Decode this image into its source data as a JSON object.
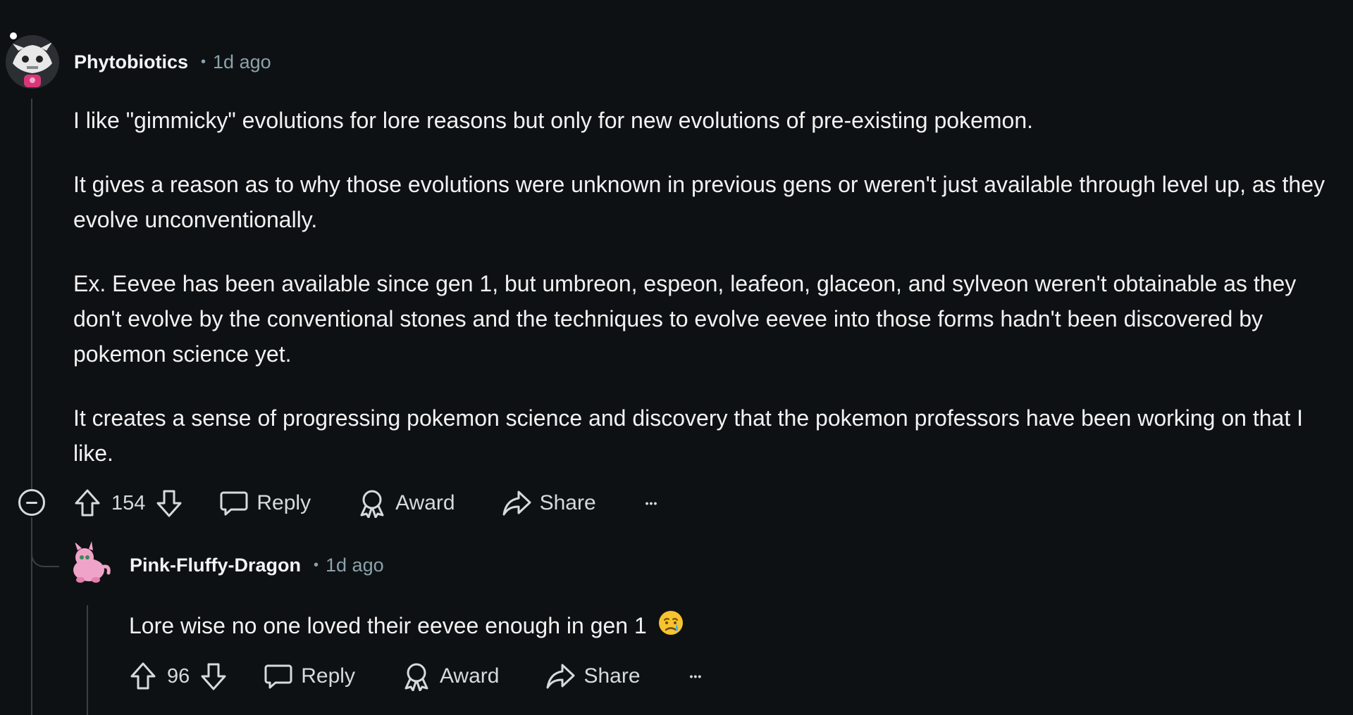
{
  "comment": {
    "author": "Phytobiotics",
    "timestamp": "1d ago",
    "paragraphs": [
      "I like \"gimmicky\" evolutions for lore reasons but only for new evolutions of pre-existing pokemon.",
      "It gives a reason as to why those evolutions were unknown in previous gens or weren't just available through level up, as they evolve unconventionally.",
      "Ex. Eevee has been available since gen 1, but umbreon, espeon, leafeon, glaceon, and sylveon weren't obtainable as they don't evolve by the conventional stones and the techniques to evolve eevee into those forms hadn't been discovered by pokemon science yet.",
      "It creates a sense of progressing pokemon science and discovery that the pokemon professors have been working on that I like."
    ],
    "votes": "154",
    "reply_label": "Reply",
    "award_label": "Award",
    "share_label": "Share",
    "more_label": "•••",
    "avatar_icon": "skull-creature-avatar"
  },
  "reply": {
    "author": "Pink-Fluffy-Dragon",
    "timestamp": "1d ago",
    "text": "Lore wise no one loved their eevee enough in gen 1",
    "emoji_icon": "crying-face-emoji",
    "votes": "96",
    "reply_label": "Reply",
    "award_label": "Award",
    "share_label": "Share",
    "more_label": "•••",
    "avatar_icon": "pink-dragon-avatar"
  },
  "colors": {
    "background": "#0e1113",
    "text": "#f2f2f2",
    "meta": "#8ba2ad",
    "thread_line": "#3a3f44"
  }
}
